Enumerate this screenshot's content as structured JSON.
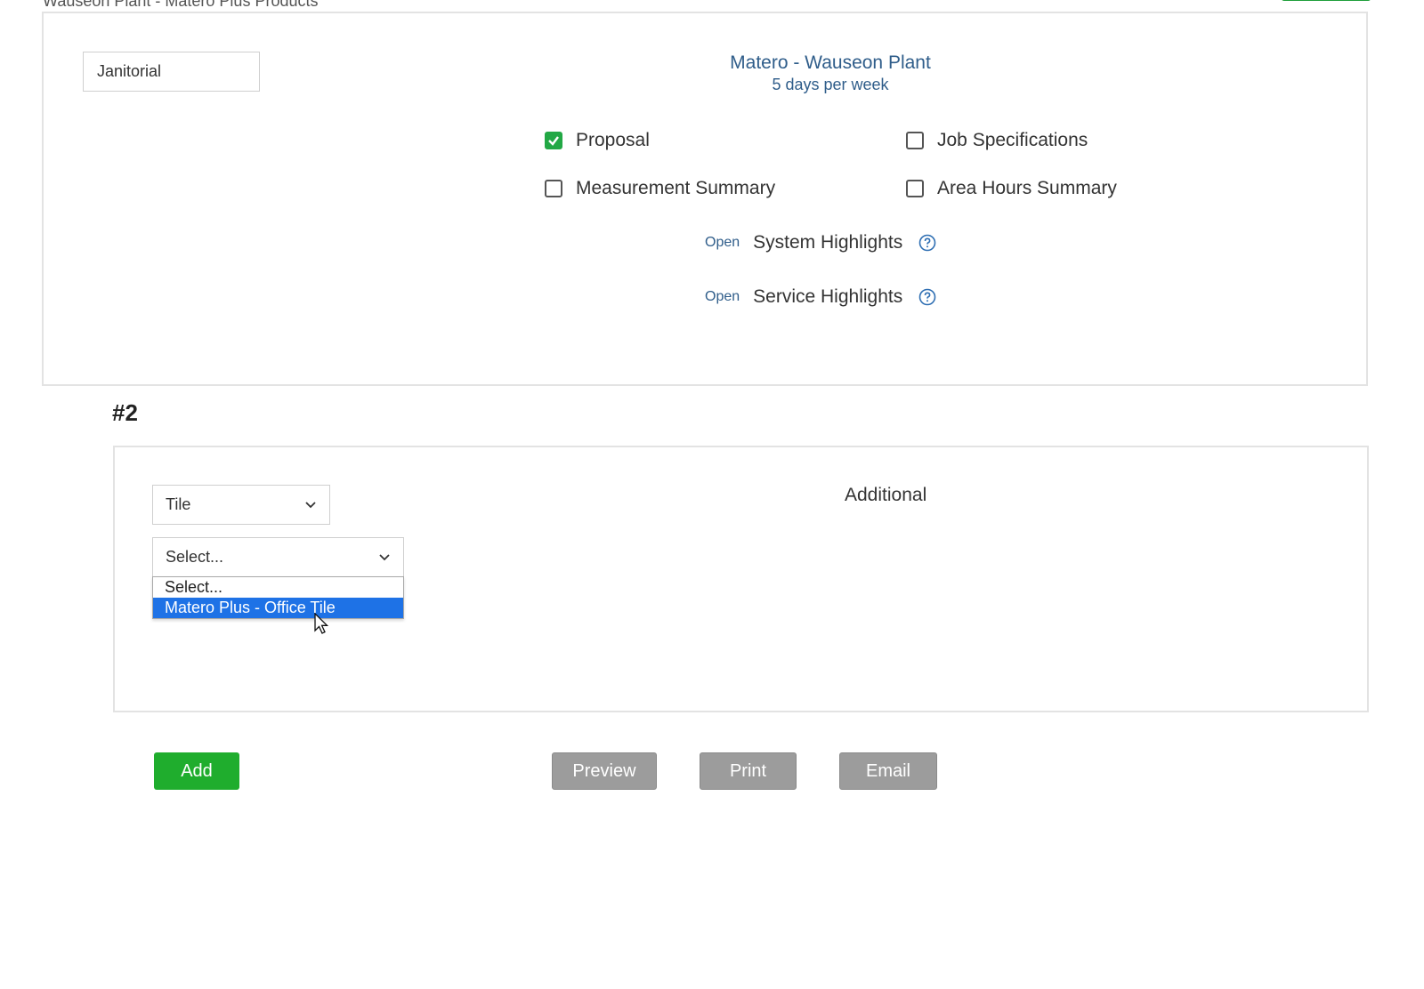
{
  "header": {
    "cut_title": "Wauseon Plant - Matero Plus Products"
  },
  "section1": {
    "service_field_value": "Janitorial",
    "location_title": "Matero - Wauseon Plant",
    "schedule": "5 days per week",
    "checkboxes": [
      {
        "label": "Proposal",
        "checked": true
      },
      {
        "label": "Job Specifications",
        "checked": false
      },
      {
        "label": "Measurement Summary",
        "checked": false
      },
      {
        "label": "Area Hours Summary",
        "checked": false
      }
    ],
    "highlights": [
      {
        "link": "Open",
        "label": "System Highlights"
      },
      {
        "link": "Open",
        "label": "Service Highlights"
      }
    ]
  },
  "section2": {
    "number": "#2",
    "type_select": "Tile",
    "product_select": "Select...",
    "dropdown_options": [
      {
        "label": "Select...",
        "selected": false
      },
      {
        "label": "Matero Plus - Office Tile",
        "selected": true
      }
    ],
    "additional_label": "Additional"
  },
  "actions": {
    "add": "Add",
    "preview": "Preview",
    "print": "Print",
    "email": "Email"
  },
  "colors": {
    "accent_green": "#1fad2d",
    "link_blue": "#2f5d8a",
    "highlight_blue": "#1e72e6",
    "button_gray": "#9c9c9c"
  }
}
